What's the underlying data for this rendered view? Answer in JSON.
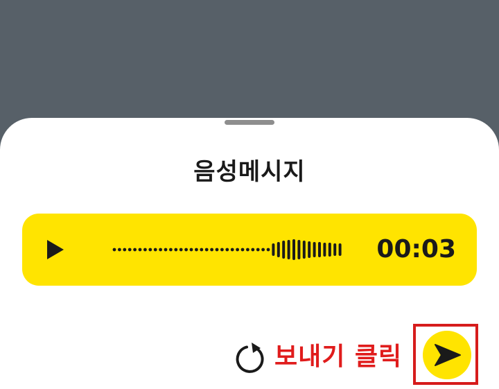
{
  "sheet": {
    "title": "음성메시지"
  },
  "player": {
    "time": "00:03",
    "dot_count": 31,
    "bar_count": 14
  },
  "actions": {
    "callout": "보내기 클릭"
  },
  "icons": {
    "play": "play-icon",
    "retry": "refresh-icon",
    "send": "send-arrow-icon"
  },
  "colors": {
    "backdrop": "#576068",
    "accent": "#ffe400",
    "callout": "#e01c1c"
  }
}
